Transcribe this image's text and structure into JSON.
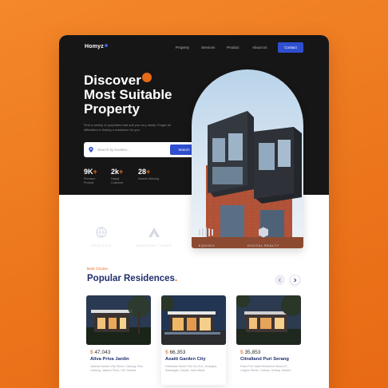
{
  "colors": {
    "accent": "#e76a17",
    "primary": "#2f4fd0",
    "navy": "#1f2e6b",
    "dark": "#161616"
  },
  "brand": "Homyz",
  "nav": {
    "links": [
      "Property",
      "Services",
      "Product",
      "About Us"
    ],
    "contact": "Contact"
  },
  "hero": {
    "title_line1": "Discover",
    "title_line2": "Most Suitable",
    "title_line3": "Property",
    "subtitle": "Find a variety of properties that suit you very easily. Forget all difficulties in finding a residence for you",
    "search_placeholder": "Search by location...",
    "search_button": "Search",
    "stats": [
      {
        "value": "9K",
        "label": "Premium Product"
      },
      {
        "value": "2k",
        "label": "Happy Customer"
      },
      {
        "value": "28",
        "label": "Awards Winning"
      }
    ]
  },
  "partners": [
    "PROLOGIS",
    "AMERICAN TOWER",
    "EQUINIX",
    "DIGITAL REALTY"
  ],
  "residences": {
    "eyebrow": "Best Choice",
    "title": "Popular Residences",
    "cards": [
      {
        "currency": "$",
        "price": "47,043",
        "name": "Aliva Priva Jardin",
        "address": "Jakarta Garden City Street, Cakung. Pulo Gadung, Jakarta Timur, DKI Jakarta"
      },
      {
        "currency": "$",
        "price": "66,353",
        "name": "Asatti Garden City",
        "address": "Pahlawan Street XVII No.215, Cinangka, Sawangan, Depok, Jawa Barat"
      },
      {
        "currency": "$",
        "price": "35,853",
        "name": "Citralland Puri Serang",
        "address": "Ruko Puri Indah Residence Block A7, Lingkar Street, Ciracas, Serang, Banten"
      }
    ]
  }
}
